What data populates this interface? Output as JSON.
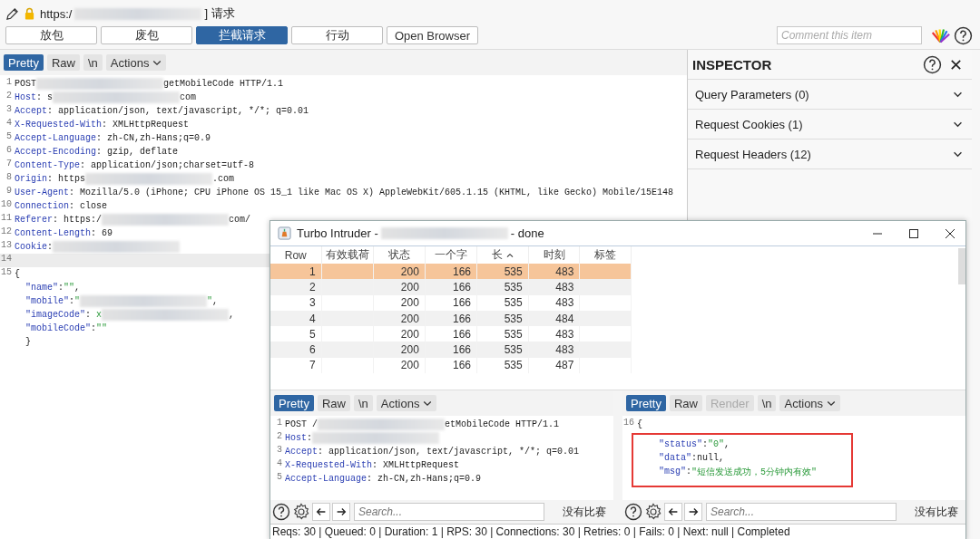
{
  "title_bar": {
    "segments": [
      {
        "kind": "plain",
        "text": "https:/"
      },
      {
        "kind": "redacted"
      },
      {
        "kind": "plain",
        "text": "] 请求"
      }
    ]
  },
  "toolbar": {
    "buttons": [
      {
        "label": "放包",
        "selected": false
      },
      {
        "label": "废包",
        "selected": false
      },
      {
        "label": "拦截请求",
        "selected": true
      },
      {
        "label": "行动",
        "selected": false
      },
      {
        "label": "Open Browser",
        "selected": false
      }
    ],
    "comment": {
      "placeholder": "Comment this item"
    }
  },
  "request_editor": {
    "tabs": [
      {
        "label": "Pretty",
        "selected": true,
        "kind": "tab"
      },
      {
        "label": "Raw",
        "selected": false,
        "kind": "tab"
      },
      {
        "label": "\\n",
        "selected": false,
        "kind": "tab"
      },
      {
        "label": "Actions",
        "selected": false,
        "kind": "menu"
      }
    ],
    "lines": [
      {
        "num": "1",
        "segments": [
          {
            "kind": "plain",
            "text": "POST"
          },
          {
            "kind": "redacted"
          },
          {
            "kind": "plain",
            "text": "getMobileCode HTTP/1.1"
          }
        ]
      },
      {
        "num": "2",
        "segments": [
          {
            "kind": "key",
            "text": "Host"
          },
          {
            "kind": "plain",
            "text": ": s"
          },
          {
            "kind": "redacted"
          },
          {
            "kind": "plain",
            "text": "com"
          }
        ]
      },
      {
        "num": "3",
        "segments": [
          {
            "kind": "key",
            "text": "Accept"
          },
          {
            "kind": "plain",
            "text": ": application/json, text/javascript, */*; q=0.01"
          }
        ]
      },
      {
        "num": "4",
        "segments": [
          {
            "kind": "key",
            "text": "X-Requested-With"
          },
          {
            "kind": "plain",
            "text": ": XMLHttpRequest"
          }
        ]
      },
      {
        "num": "5",
        "segments": [
          {
            "kind": "key",
            "text": "Accept-Language"
          },
          {
            "kind": "plain",
            "text": ": zh-CN,zh-Hans;q=0.9"
          }
        ]
      },
      {
        "num": "6",
        "segments": [
          {
            "kind": "key",
            "text": "Accept-Encoding"
          },
          {
            "kind": "plain",
            "text": ": gzip, deflate"
          }
        ]
      },
      {
        "num": "7",
        "segments": [
          {
            "kind": "key",
            "text": "Content-Type"
          },
          {
            "kind": "plain",
            "text": ": application/json;charset=utf-8"
          }
        ]
      },
      {
        "num": "8",
        "segments": [
          {
            "kind": "key",
            "text": "Origin"
          },
          {
            "kind": "plain",
            "text": ": https"
          },
          {
            "kind": "redacted"
          },
          {
            "kind": "plain",
            "text": ".com"
          }
        ]
      },
      {
        "num": "9",
        "segments": [
          {
            "kind": "key",
            "text": "User-Agent"
          },
          {
            "kind": "plain",
            "text": ": Mozilla/5.0 (iPhone; CPU iPhone OS 15_1 like Mac OS X) AppleWebKit/605.1.15 (KHTML, like Gecko) Mobile/15E148"
          }
        ]
      },
      {
        "num": "10",
        "segments": [
          {
            "kind": "key",
            "text": "Connection"
          },
          {
            "kind": "plain",
            "text": ": close"
          }
        ]
      },
      {
        "num": "11",
        "segments": [
          {
            "kind": "key",
            "text": "Referer"
          },
          {
            "kind": "plain",
            "text": ": https:/"
          },
          {
            "kind": "redacted"
          },
          {
            "kind": "plain",
            "text": "com/"
          }
        ]
      },
      {
        "num": "12",
        "segments": [
          {
            "kind": "key",
            "text": "Content-Length"
          },
          {
            "kind": "plain",
            "text": ": 69"
          }
        ]
      },
      {
        "num": "13",
        "segments": [
          {
            "kind": "key",
            "text": "Cookie"
          },
          {
            "kind": "plain",
            "text": ":"
          },
          {
            "kind": "redacted"
          }
        ]
      },
      {
        "num": "14"
      },
      {
        "num": "15",
        "segments": [
          {
            "kind": "plain",
            "text": "{"
          }
        ]
      },
      {
        "segments": [
          {
            "kind": "jkey",
            "text": "\"name\""
          },
          {
            "kind": "plain",
            "text": ":"
          },
          {
            "kind": "jstr",
            "text": "\"\""
          },
          {
            "kind": "plain",
            "text": ","
          }
        ]
      },
      {
        "segments": [
          {
            "kind": "jkey",
            "text": "\"mobile\""
          },
          {
            "kind": "plain",
            "text": ":"
          },
          {
            "kind": "jstr",
            "text": "\""
          },
          {
            "kind": "redacted"
          },
          {
            "kind": "jstr",
            "text": "\""
          },
          {
            "kind": "plain",
            "text": ","
          }
        ]
      },
      {
        "segments": [
          {
            "kind": "jkey",
            "text": "\"imageCode\""
          },
          {
            "kind": "plain",
            "text": ":"
          },
          {
            "kind": "jstr",
            "text": " x"
          },
          {
            "kind": "redacted"
          },
          {
            "kind": "plain",
            "text": ","
          }
        ]
      },
      {
        "segments": [
          {
            "kind": "jkey",
            "text": "\"mobileCode\""
          },
          {
            "kind": "plain",
            "text": ":"
          },
          {
            "kind": "jstr",
            "text": "\"\""
          }
        ]
      },
      {
        "segments": [
          {
            "kind": "plain",
            "text": "}"
          }
        ]
      }
    ]
  },
  "inspector": {
    "title": "INSPECTOR",
    "sections": [
      {
        "label": "Query Parameters (0)",
        "expanded": false
      },
      {
        "label": "Request Cookies (1)",
        "expanded": false
      },
      {
        "label": "Request Headers (12)",
        "expanded": false
      }
    ]
  },
  "turbo_intruder": {
    "title": [
      {
        "kind": "plain",
        "text": "Turbo Intruder -"
      },
      {
        "kind": "redacted"
      },
      {
        "kind": "plain",
        "text": "- done"
      }
    ],
    "columns": [
      {
        "label": "Row",
        "sorted": false
      },
      {
        "label": "有效载荷",
        "sorted": false
      },
      {
        "label": "状态",
        "sorted": false
      },
      {
        "label": "一个字",
        "sorted": false
      },
      {
        "label": "长",
        "sorted": true
      },
      {
        "label": "时刻",
        "sorted": false
      },
      {
        "label": "标签",
        "sorted": false
      }
    ],
    "rows": [
      {
        "selected": true,
        "cells": [
          "1",
          "",
          "200",
          "166",
          "535",
          "483",
          ""
        ]
      },
      {
        "selected": false,
        "cells": [
          "2",
          "",
          "200",
          "166",
          "535",
          "483",
          ""
        ]
      },
      {
        "selected": false,
        "cells": [
          "3",
          "",
          "200",
          "166",
          "535",
          "483",
          ""
        ]
      },
      {
        "selected": false,
        "cells": [
          "4",
          "",
          "200",
          "166",
          "535",
          "484",
          ""
        ]
      },
      {
        "selected": false,
        "cells": [
          "5",
          "",
          "200",
          "166",
          "535",
          "483",
          ""
        ]
      },
      {
        "selected": false,
        "cells": [
          "6",
          "",
          "200",
          "166",
          "535",
          "483",
          ""
        ]
      },
      {
        "selected": false,
        "cells": [
          "7",
          "",
          "200",
          "166",
          "535",
          "487",
          ""
        ]
      }
    ],
    "request_pane": {
      "tabs": [
        {
          "label": "Pretty",
          "selected": true,
          "kind": "tab"
        },
        {
          "label": "Raw",
          "selected": false,
          "kind": "tab"
        },
        {
          "label": "\\n",
          "selected": false,
          "kind": "tab"
        },
        {
          "label": "Actions",
          "selected": false,
          "kind": "menu"
        }
      ],
      "lines": [
        {
          "num": "1",
          "segments": [
            {
              "kind": "plain",
              "text": "POST /"
            },
            {
              "kind": "redacted"
            },
            {
              "kind": "plain",
              "text": "etMobileCode HTTP/1.1"
            }
          ]
        },
        {
          "num": "2",
          "segments": [
            {
              "kind": "key",
              "text": "Host"
            },
            {
              "kind": "plain",
              "text": ":"
            },
            {
              "kind": "redacted"
            }
          ]
        },
        {
          "num": "3",
          "segments": [
            {
              "kind": "key",
              "text": "Accept"
            },
            {
              "kind": "plain",
              "text": ": application/json, text/javascript, */*; q=0.01"
            }
          ]
        },
        {
          "num": "4",
          "segments": [
            {
              "kind": "key",
              "text": "X-Requested-With"
            },
            {
              "kind": "plain",
              "text": ": XMLHttpRequest"
            }
          ]
        },
        {
          "num": "5",
          "segments": [
            {
              "kind": "key",
              "text": "Accept-Language"
            },
            {
              "kind": "plain",
              "text": ": zh-CN,zh-Hans;q=0.9"
            }
          ]
        }
      ],
      "search": {
        "placeholder": "Search..."
      },
      "result": "没有比赛"
    },
    "response_pane": {
      "tabs": [
        {
          "label": "Pretty",
          "selected": true,
          "kind": "tab",
          "disabled": false
        },
        {
          "label": "Raw",
          "selected": false,
          "kind": "tab",
          "disabled": false
        },
        {
          "label": "Render",
          "selected": false,
          "kind": "tab",
          "disabled": true
        },
        {
          "label": "\\n",
          "selected": false,
          "kind": "tab",
          "disabled": false
        },
        {
          "label": "Actions",
          "selected": false,
          "kind": "menu",
          "disabled": false
        }
      ],
      "lines": [
        {
          "num": "16",
          "highlighted": false,
          "segments": [
            {
              "kind": "plain",
              "text": "{"
            }
          ]
        },
        {
          "highlighted": true,
          "segments": [
            {
              "kind": "jkey",
              "text": "\"status\""
            },
            {
              "kind": "plain",
              "text": ":"
            },
            {
              "kind": "jstr",
              "text": "\"0\""
            },
            {
              "kind": "plain",
              "text": ","
            }
          ]
        },
        {
          "highlighted": true,
          "segments": [
            {
              "kind": "jkey",
              "text": "\"data\""
            },
            {
              "kind": "plain",
              "text": ":null,"
            }
          ]
        },
        {
          "highlighted": true,
          "segments": [
            {
              "kind": "jkey",
              "text": "\"msg\""
            },
            {
              "kind": "plain",
              "text": ":"
            },
            {
              "kind": "jstr",
              "text": "\"短信发送成功，5分钟内有效\""
            }
          ]
        }
      ],
      "search": {
        "placeholder": "Search..."
      },
      "result": "没有比赛"
    },
    "status": "Reqs: 30 | Queued: 0 | Duration: 1 | RPS: 30 | Connections: 30 | Retries: 0 | Fails: 0 | Next: null | Completed"
  }
}
